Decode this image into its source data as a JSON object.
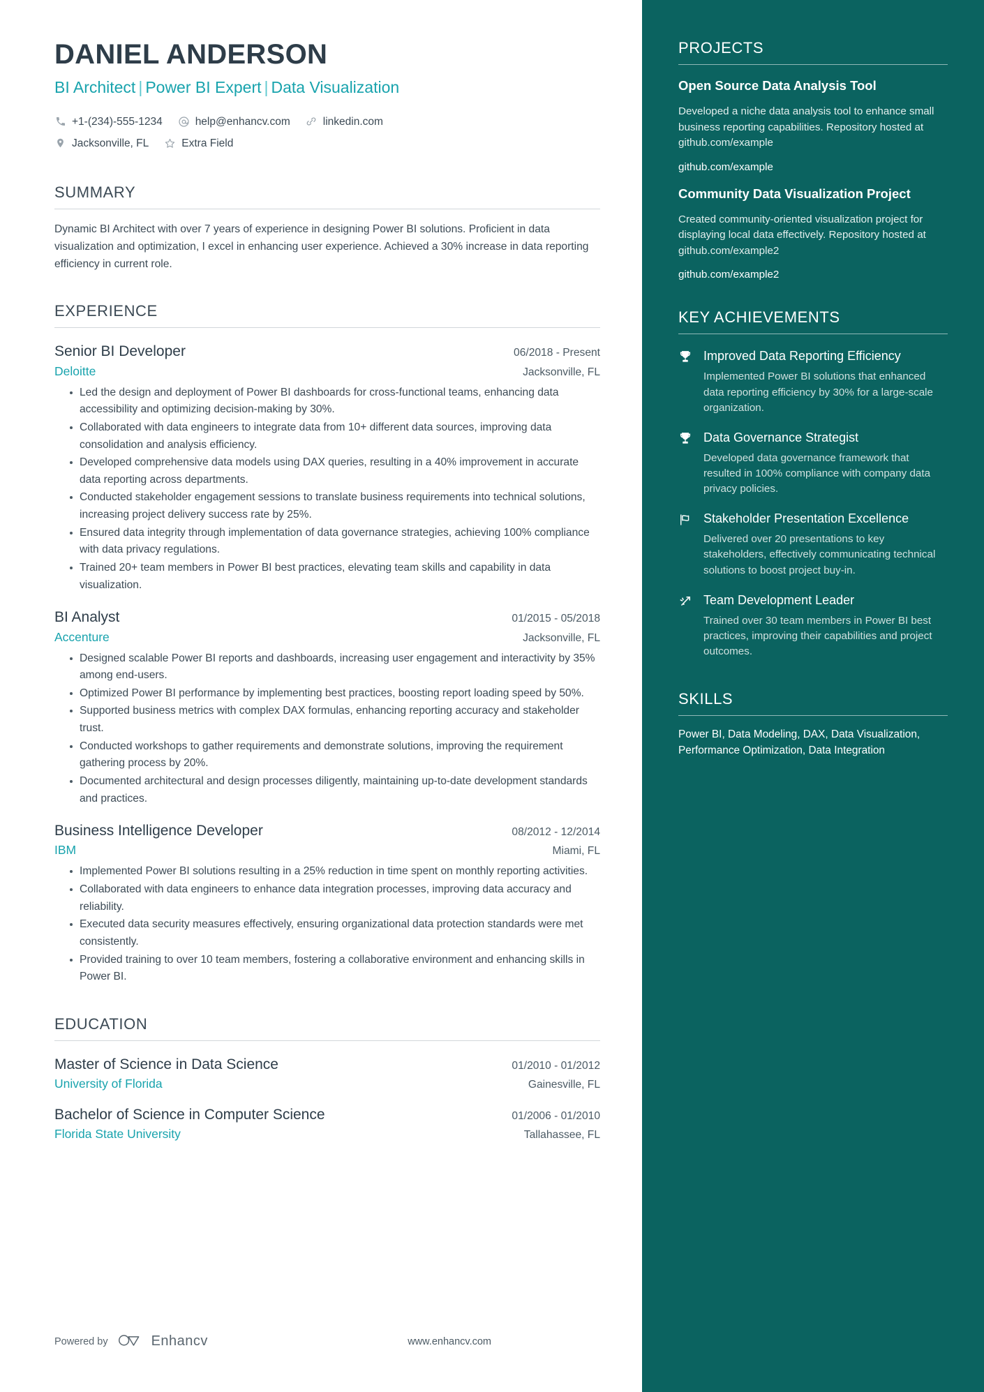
{
  "header": {
    "name": "DANIEL ANDERSON",
    "headline_parts": [
      "BI Architect",
      "Power BI Expert",
      "Data Visualization"
    ],
    "headline_separator": "|",
    "contacts_row1": [
      {
        "icon": "phone-icon",
        "text": "+1-(234)-555-1234"
      },
      {
        "icon": "at-sign-icon",
        "text": "help@enhancv.com"
      },
      {
        "icon": "link-icon",
        "text": "linkedin.com"
      }
    ],
    "contacts_row2": [
      {
        "icon": "location-pin-icon",
        "text": "Jacksonville, FL"
      },
      {
        "icon": "star-icon",
        "text": "Extra Field"
      }
    ]
  },
  "summary": {
    "title": "SUMMARY",
    "text": "Dynamic BI Architect with over 7 years of experience in designing Power BI solutions. Proficient in data visualization and optimization, I excel in enhancing user experience. Achieved a 30% increase in data reporting efficiency in current role."
  },
  "experience": {
    "title": "EXPERIENCE",
    "entries": [
      {
        "role": "Senior BI Developer",
        "date": "06/2018 - Present",
        "company": "Deloitte",
        "location": "Jacksonville, FL",
        "bullets": [
          "Led the design and deployment of Power BI dashboards for cross-functional teams, enhancing data accessibility and optimizing decision-making by 30%.",
          "Collaborated with data engineers to integrate data from 10+ different data sources, improving data consolidation and analysis efficiency.",
          "Developed comprehensive data models using DAX queries, resulting in a 40% improvement in accurate data reporting across departments.",
          "Conducted stakeholder engagement sessions to translate business requirements into technical solutions, increasing project delivery success rate by 25%.",
          "Ensured data integrity through implementation of data governance strategies, achieving 100% compliance with data privacy regulations.",
          "Trained 20+ team members in Power BI best practices, elevating team skills and capability in data visualization."
        ]
      },
      {
        "role": "BI Analyst",
        "date": "01/2015 - 05/2018",
        "company": "Accenture",
        "location": "Jacksonville, FL",
        "bullets": [
          "Designed scalable Power BI reports and dashboards, increasing user engagement and interactivity by 35% among end-users.",
          "Optimized Power BI performance by implementing best practices, boosting report loading speed by 50%.",
          "Supported business metrics with complex DAX formulas, enhancing reporting accuracy and stakeholder trust.",
          "Conducted workshops to gather requirements and demonstrate solutions, improving the requirement gathering process by 20%.",
          "Documented architectural and design processes diligently, maintaining up-to-date development standards and practices."
        ]
      },
      {
        "role": "Business Intelligence Developer",
        "date": "08/2012 - 12/2014",
        "company": "IBM",
        "location": "Miami, FL",
        "bullets": [
          "Implemented Power BI solutions resulting in a 25% reduction in time spent on monthly reporting activities.",
          "Collaborated with data engineers to enhance data integration processes, improving data accuracy and reliability.",
          "Executed data security measures effectively, ensuring organizational data protection standards were met consistently.",
          "Provided training to over 10 team members, fostering a collaborative environment and enhancing skills in Power BI."
        ]
      }
    ]
  },
  "education": {
    "title": "EDUCATION",
    "entries": [
      {
        "degree": "Master of Science in Data Science",
        "date": "01/2010 - 01/2012",
        "school": "University of Florida",
        "location": "Gainesville, FL"
      },
      {
        "degree": "Bachelor of Science in Computer Science",
        "date": "01/2006 - 01/2010",
        "school": "Florida State University",
        "location": "Tallahassee, FL"
      }
    ]
  },
  "footer": {
    "powered_by": "Powered by",
    "brand": "Enhancv",
    "url": "www.enhancv.com"
  },
  "sidebar": {
    "projects": {
      "title": "PROJECTS",
      "items": [
        {
          "name": "Open Source Data Analysis Tool",
          "description": "Developed a niche data analysis tool to enhance small business reporting capabilities. Repository hosted at github.com/example",
          "link": "github.com/example"
        },
        {
          "name": "Community Data Visualization Project",
          "description": "Created community-oriented visualization project for displaying local data effectively. Repository hosted at github.com/example2",
          "link": "github.com/example2"
        }
      ]
    },
    "achievements": {
      "title": "KEY ACHIEVEMENTS",
      "items": [
        {
          "icon": "trophy-icon",
          "title": "Improved Data Reporting Efficiency",
          "description": "Implemented Power BI solutions that enhanced data reporting efficiency by 30% for a large-scale organization."
        },
        {
          "icon": "trophy-icon",
          "title": "Data Governance Strategist",
          "description": "Developed data governance framework that resulted in 100% compliance with company data privacy policies."
        },
        {
          "icon": "flag-icon",
          "title": "Stakeholder Presentation Excellence",
          "description": "Delivered over 20 presentations to key stakeholders, effectively communicating technical solutions to boost project buy-in."
        },
        {
          "icon": "rocket-icon",
          "title": "Team Development Leader",
          "description": "Trained over 30 team members in Power BI best practices, improving their capabilities and project outcomes."
        }
      ]
    },
    "skills": {
      "title": "SKILLS",
      "text": "Power BI, Data Modeling, DAX, Data Visualization, Performance Optimization, Data Integration"
    }
  },
  "colors": {
    "sidebar_bg": "#0b6360",
    "accent_teal": "#18a3ad",
    "body_text": "#3c4a55"
  }
}
